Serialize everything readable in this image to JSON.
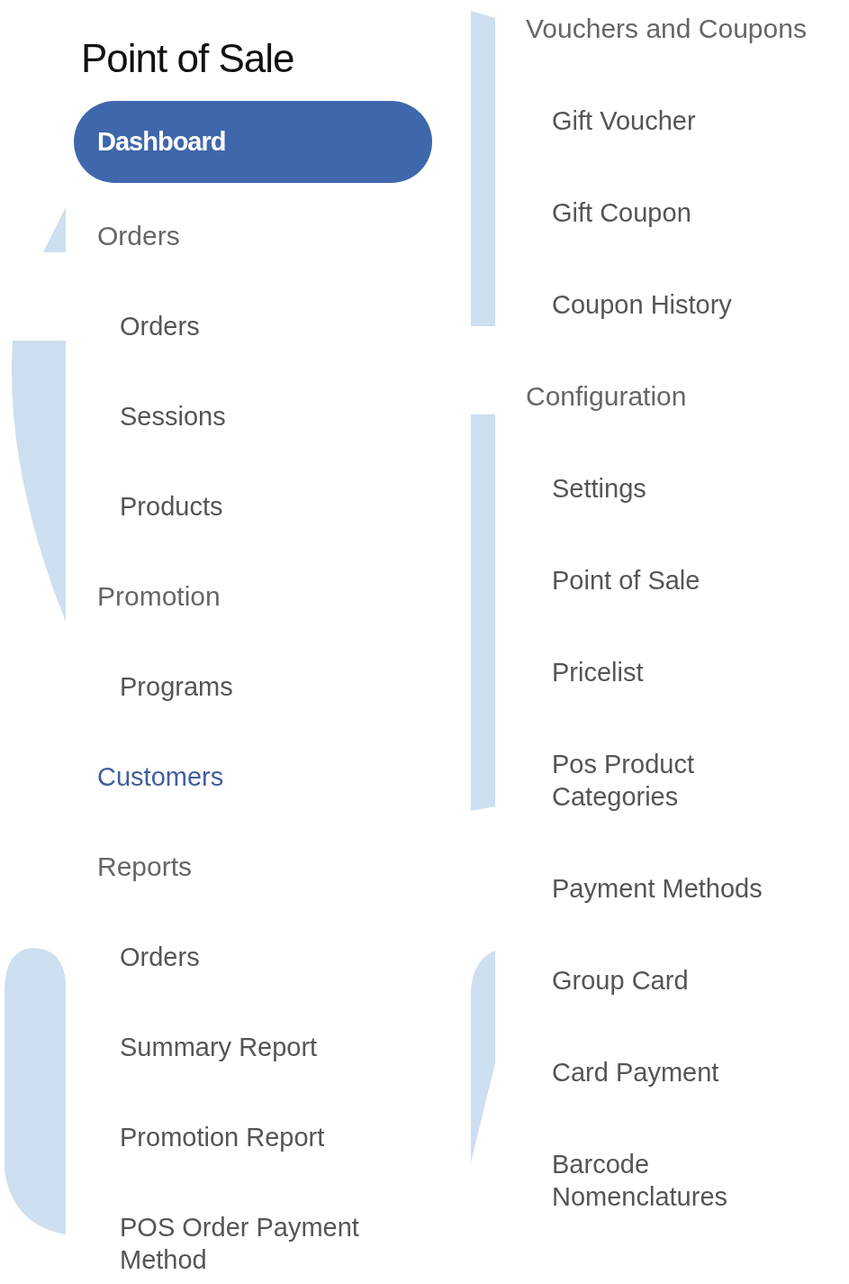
{
  "title": "Point of Sale",
  "columns": [
    {
      "entries": [
        {
          "kind": "item",
          "label": "Dashboard",
          "selected": true
        },
        {
          "kind": "header",
          "label": "Orders",
          "selected": false
        },
        {
          "kind": "sub",
          "label": "Orders",
          "selected": false
        },
        {
          "kind": "sub",
          "label": "Sessions",
          "selected": false
        },
        {
          "kind": "sub",
          "label": "Products",
          "selected": false
        },
        {
          "kind": "header",
          "label": "Promotion",
          "selected": false
        },
        {
          "kind": "sub",
          "label": "Programs",
          "selected": false
        },
        {
          "kind": "link",
          "label": "Customers",
          "selected": false
        },
        {
          "kind": "header",
          "label": "Reports",
          "selected": false
        },
        {
          "kind": "sub",
          "label": "Orders",
          "selected": false
        },
        {
          "kind": "sub",
          "label": "Summary Report",
          "selected": false
        },
        {
          "kind": "sub",
          "label": "Promotion Report",
          "selected": false
        },
        {
          "kind": "sub",
          "label": "POS Order Payment Method",
          "selected": false
        }
      ]
    },
    {
      "entries": [
        {
          "kind": "header",
          "label": "Vouchers and Coupons",
          "selected": false
        },
        {
          "kind": "sub",
          "label": "Gift Voucher",
          "selected": false
        },
        {
          "kind": "sub",
          "label": "Gift Coupon",
          "selected": false
        },
        {
          "kind": "sub",
          "label": "Coupon History",
          "selected": false
        },
        {
          "kind": "header",
          "label": "Configuration",
          "selected": false
        },
        {
          "kind": "sub",
          "label": "Settings",
          "selected": false
        },
        {
          "kind": "sub",
          "label": "Point of Sale",
          "selected": false
        },
        {
          "kind": "sub",
          "label": "Pricelist",
          "selected": false
        },
        {
          "kind": "sub",
          "label": "Pos Product Categories",
          "selected": false
        },
        {
          "kind": "sub",
          "label": "Payment Methods",
          "selected": false
        },
        {
          "kind": "sub",
          "label": "Group Card",
          "selected": false
        },
        {
          "kind": "sub",
          "label": "Card Payment",
          "selected": false
        },
        {
          "kind": "sub",
          "label": "Barcode Nomenclatures",
          "selected": false
        }
      ]
    }
  ]
}
